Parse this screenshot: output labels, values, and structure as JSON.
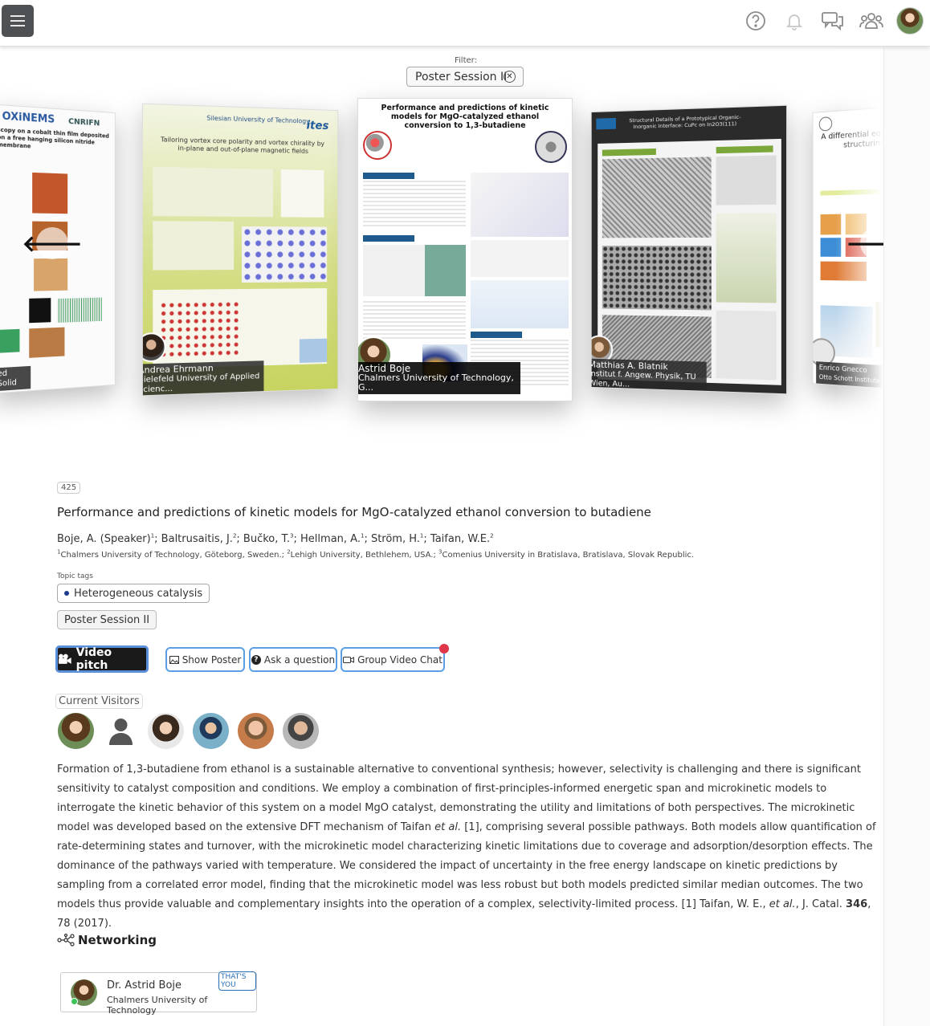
{
  "topbar": {
    "icons": [
      "help-icon",
      "bell-icon",
      "chat-icon",
      "people-icon"
    ]
  },
  "filter": {
    "label": "Filter:",
    "chip": "Poster Session II",
    "clear": "⊗"
  },
  "carousel": {
    "prev": "🡐",
    "next": "🡒",
    "posters": [
      {
        "name": "",
        "affiliation": "ed Solid",
        "logo_text": "OXiNEMS",
        "logo_text2": "CNRIFN",
        "title": "scopy on a cobalt thin film deposited on a free hanging silicon nitride membrane"
      },
      {
        "name": "Andrea Ehrmann",
        "affiliation": "Bielefeld University of Applied Scienc...",
        "logo_text": "Silesian University of Technology",
        "logo_text2": "ites",
        "title": "Tailoring vortex core polarity and vortex chirality by in-plane and out-of-plane magnetic fields"
      },
      {
        "name": "Astrid Boje",
        "affiliation": "Chalmers University of Technology, G...",
        "title": "Performance and predictions of kinetic models for MgO-catalyzed ethanol conversion to 1,3-butadiene"
      },
      {
        "name": "Matthias A. Blatnik",
        "affiliation": "Institut f. Angew. Physik, TU Wien, Au...",
        "title": "Structural Details of a Prototypical Organic-Inorganic Interface: CuPc on In2O3(111)"
      },
      {
        "name": "Enrico Gnecco",
        "affiliation": "Otto Schott Institute of Materials Res...",
        "title": "A differential equation for structuring of"
      }
    ]
  },
  "detail": {
    "id": "425",
    "title": "Performance and predictions of kinetic models for MgO-catalyzed ethanol conversion to butadiene",
    "authors_html": "Boje, A. (Speaker)<sup>1</sup>; Baltrusaitis, J.<sup>2</sup>; Bučko, T.<sup>3</sup>; Hellman, A.<sup>1</sup>; Ström, H.<sup>1</sup>; Taifan, W.E.<sup>2</sup>",
    "affiliations_html": "<sup>1</sup>Chalmers University of Technology, Göteborg, Sweden.; <sup>2</sup>Lehigh University, Bethlehem, USA.; <sup>3</sup>Comenius University in Bratislava, Bratislava, Slovak Republic.",
    "topic_tags_label": "Topic tags",
    "topic_tag": "Heterogeneous catalysis",
    "session_tag": "Poster Session II",
    "buttons": {
      "video_pitch": "Video pitch",
      "show_poster": "Show Poster",
      "ask_question": "Ask a question",
      "group_video_chat": "Group Video Chat"
    },
    "current_visitors_label": "Current Visitors",
    "visitors": [
      "visitor-1",
      "visitor-2",
      "visitor-3",
      "visitor-4",
      "visitor-5",
      "visitor-6"
    ],
    "abstract": {
      "p1": "Formation of 1,3-butadiene from ethanol is a sustainable alternative to conventional synthesis; however, selectivity is challenging and there is significant sensitivity to catalyst composition and conditions. We employ a combination of first-principles-informed energetic span and microkinetic models to interrogate the kinetic behavior of this system on a model MgO catalyst, demonstrating the utility and limitations of both perspectives. The microkinetic model was developed based on the extensive DFT mechanism of Taifan ",
      "etal1": "et al.",
      "p2": " [1], comprising several possible pathways. Both models allow quantification of rate-determining states and turnover, with the microkinetic model characterizing kinetic limitations due to coverage and adsorption/desorption effects. The dominance of the pathways varied with temperature. We considered the impact of uncertainty in the free energy landscape on kinetic predictions by sampling from a correlated error model, finding that the microkinetic model was less robust but both models predicted similar median outcomes. The two models thus provide valuable and complementary insights into the operation of a complex, selectivity-limited process. [1] Taifan, W. E., ",
      "etal2": "et al.",
      "p3": ", J. Catal. ",
      "vol": "346",
      "p4": ", 78 (2017)."
    }
  },
  "networking": {
    "title": "Networking",
    "card": {
      "name": "Dr. Astrid Boje",
      "affiliation": "Chalmers University of Technology",
      "badge": "THAT'S YOU"
    }
  },
  "colors": {
    "button_border": "#5a9ee6",
    "notification": "#e0364a",
    "online": "#3cc45a",
    "poster2_bg": "#c9d66a"
  }
}
